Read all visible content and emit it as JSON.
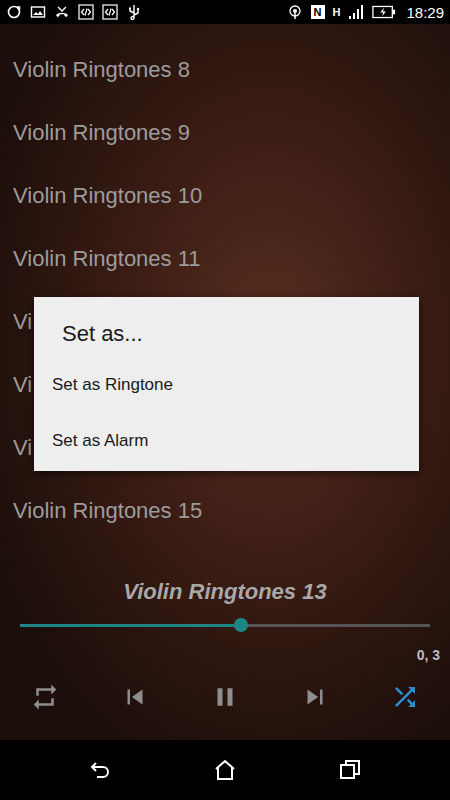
{
  "status_bar": {
    "time": "18:29",
    "nfc": "N",
    "network": "H"
  },
  "ringtones": [
    {
      "title": "Violin Ringtones 8"
    },
    {
      "title": "Violin Ringtones 9"
    },
    {
      "title": "Violin Ringtones 10"
    },
    {
      "title": "Violin Ringtones 11"
    },
    {
      "title": "Vi"
    },
    {
      "title": "Vi"
    },
    {
      "title": "Vi"
    },
    {
      "title": "Violin Ringtones 15"
    }
  ],
  "dialog": {
    "title": "Set as...",
    "options": [
      "Set as Ringtone",
      "Set as Alarm"
    ]
  },
  "player": {
    "now_playing": "Violin Ringtones 13",
    "level": 0.54,
    "time": "0, 3",
    "playing": true,
    "repeat": false,
    "shuffle": true
  }
}
